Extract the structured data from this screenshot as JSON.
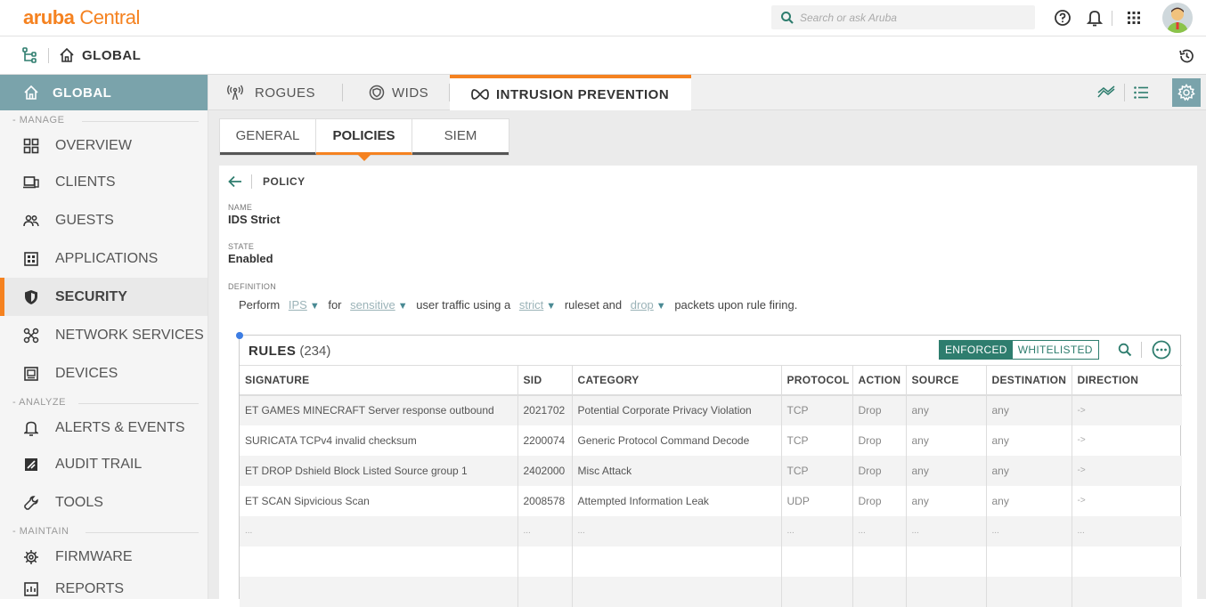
{
  "app": {
    "brand": "aruba",
    "product": "Central"
  },
  "search": {
    "placeholder": "Search or ask Aruba"
  },
  "context": {
    "title": "GLOBAL"
  },
  "sidebar": {
    "global_label": "GLOBAL",
    "sections": {
      "manage": "MANAGE",
      "analyze": "ANALYZE",
      "maintain": "MAINTAIN"
    },
    "items": {
      "overview": "OVERVIEW",
      "clients": "CLIENTS",
      "guests": "GUESTS",
      "applications": "APPLICATIONS",
      "security": "SECURITY",
      "network_services": "NETWORK SERVICES",
      "devices": "DEVICES",
      "alerts": "ALERTS & EVENTS",
      "audit": "AUDIT TRAIL",
      "tools": "TOOLS",
      "firmware": "FIRMWARE",
      "reports": "REPORTS"
    }
  },
  "tabs": {
    "rogues": "ROGUES",
    "wids": "WIDS",
    "ips": "INTRUSION PREVENTION"
  },
  "subtabs": {
    "general": "GENERAL",
    "policies": "POLICIES",
    "siem": "SIEM"
  },
  "policy": {
    "header": "POLICY",
    "name_label": "NAME",
    "name_value": "IDS Strict",
    "state_label": "STATE",
    "state_value": "Enabled",
    "definition_label": "DEFINITION",
    "def": {
      "t1": "Perform",
      "o1": "IPS",
      "t2": "for",
      "o2": "sensitive",
      "t3": "user traffic using a",
      "o3": "strict",
      "t4": "ruleset and",
      "o4": "drop",
      "t5": "packets upon rule firing."
    }
  },
  "rules": {
    "title": "RULES",
    "count": "(234)",
    "enforced": "ENFORCED",
    "whitelisted": "WHITELISTED",
    "columns": {
      "signature": "SIGNATURE",
      "sid": "SID",
      "category": "CATEGORY",
      "protocol": "PROTOCOL",
      "action": "ACTION",
      "source": "SOURCE",
      "destination": "DESTINATION",
      "direction": "DIRECTION"
    },
    "rows": [
      {
        "signature": "ET GAMES MINECRAFT Server response outbound",
        "sid": "2021702",
        "category": "Potential Corporate Privacy Violation",
        "protocol": "TCP",
        "action": "Drop",
        "source": "any",
        "destination": "any",
        "direction": "->"
      },
      {
        "signature": "SURICATA TCPv4 invalid checksum",
        "sid": "2200074",
        "category": "Generic Protocol Command Decode",
        "protocol": "TCP",
        "action": "Drop",
        "source": "any",
        "destination": "any",
        "direction": "->"
      },
      {
        "signature": "ET DROP Dshield Block Listed Source group 1",
        "sid": "2402000",
        "category": "Misc Attack",
        "protocol": "TCP",
        "action": "Drop",
        "source": "any",
        "destination": "any",
        "direction": "->"
      },
      {
        "signature": "ET SCAN Sipvicious Scan",
        "sid": "2008578",
        "category": "Attempted Information Leak",
        "protocol": "UDP",
        "action": "Drop",
        "source": "any",
        "destination": "any",
        "direction": "->"
      },
      {
        "signature": "...",
        "sid": "...",
        "category": "...",
        "protocol": "...",
        "action": "...",
        "source": "...",
        "destination": "...",
        "direction": "..."
      }
    ]
  },
  "colors": {
    "accent": "#f58220",
    "teal": "#2e7d6e",
    "sidebar_active": "#7aa3ab"
  }
}
